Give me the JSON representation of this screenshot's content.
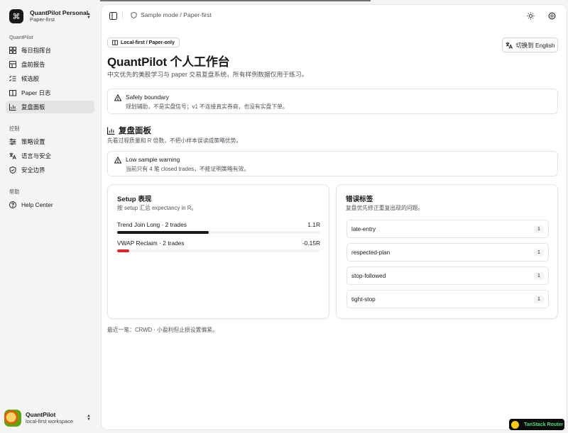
{
  "workspace": {
    "logo_glyph": "⌘",
    "title": "QuantPilot Personal",
    "subtitle": "Paper-first"
  },
  "sidebar": {
    "groups": [
      {
        "label": "QuantPilot",
        "items": [
          {
            "label": "每日指挥台",
            "icon": "grid-icon"
          },
          {
            "label": "盘前报告",
            "icon": "table-icon"
          },
          {
            "label": "候选股",
            "icon": "list-checks-icon"
          },
          {
            "label": "Paper 日志",
            "icon": "book-icon"
          },
          {
            "label": "复盘面板",
            "icon": "bar-chart-icon",
            "active": true
          }
        ]
      },
      {
        "label": "控制",
        "items": [
          {
            "label": "策略设置",
            "icon": "sliders-icon"
          },
          {
            "label": "语言与安全",
            "icon": "languages-icon"
          },
          {
            "label": "安全边界",
            "icon": "shield-check-icon"
          }
        ]
      },
      {
        "label": "帮助",
        "items": [
          {
            "label": "Help Center",
            "icon": "help-circle-icon"
          }
        ]
      }
    ]
  },
  "user": {
    "name": "QuantPilot",
    "subtitle": "local-first workspace"
  },
  "header": {
    "breadcrumb": "Sample mode / Paper-first"
  },
  "page": {
    "badge": "Local-first / Paper-only",
    "lang_button": "切换到 English",
    "title": "QuantPilot 个人工作台",
    "subtitle": "中文优先的美股学习与 paper 交易复盘系统，所有样例数据仅用于练习。"
  },
  "safety_alert": {
    "title": "Safety boundary",
    "text": "规划辅助，不是实盘信号；v1 不连接真实券商，也没有实盘下单。"
  },
  "review": {
    "title": "复盘面板",
    "subtitle": "先看过程质量和 R 倍数，不把小样本误读成策略优势。",
    "warning": {
      "title": "Low sample warning",
      "text": "当前只有 4 笔 closed trades，不能证明策略有效。"
    },
    "setup_card": {
      "title": "Setup 表现",
      "subtitle": "按 setup 汇总 expectancy in R。",
      "rows": [
        {
          "label": "Trend Join Long · 2 trades",
          "value": "1.1R",
          "fraction": 0.45,
          "color": "#18181b"
        },
        {
          "label": "VWAP Reclaim · 2 trades",
          "value": "-0.15R",
          "fraction": 0.06,
          "color": "#dc2626"
        }
      ]
    },
    "tags_card": {
      "title": "错误标签",
      "subtitle": "复盘优先修正重复出现的问题。",
      "tags": [
        {
          "label": "late-entry",
          "count": "1"
        },
        {
          "label": "respected-plan",
          "count": "1"
        },
        {
          "label": "stop-followed",
          "count": "1"
        },
        {
          "label": "tight-stop",
          "count": "1"
        }
      ]
    },
    "footnote": "最近一笔：CRWD · 小盈利但止损设置偏紧。"
  },
  "devtools": {
    "label": "TanStack Router"
  }
}
